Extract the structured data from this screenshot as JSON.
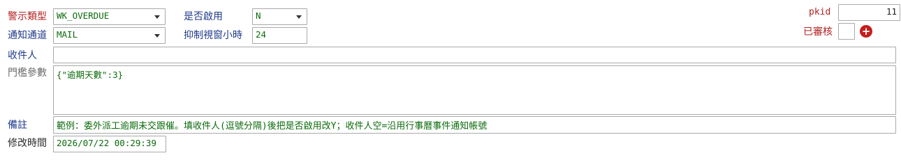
{
  "row1": {
    "alert_type_label": "警示類型",
    "alert_type_value": "WK_OVERDUE",
    "enabled_label": "是否啟用",
    "enabled_value": "N"
  },
  "row2": {
    "channel_label": "通知通道",
    "channel_value": "MAIL",
    "suppress_label": "抑制視窗小時",
    "suppress_value": "24"
  },
  "right": {
    "pkid_label": "pkid",
    "pkid_value": "11",
    "reviewed_label": "已審核",
    "add_icon": "plus-circle-icon"
  },
  "recipients": {
    "label": "收件人",
    "value": ""
  },
  "threshold": {
    "label": "門檻參數",
    "value": "{\"逾期天數\":3}"
  },
  "remark": {
    "label": "備註",
    "value": "範例：委外派工逾期未交跟催。填收件人(逗號分隔)後把是否啟用改Y；收件人空=沿用行事曆事件通知帳號"
  },
  "modified": {
    "label": "修改時間",
    "value": "2026/07/22 00:29:39"
  },
  "colors": {
    "required_label": "#b22222",
    "optional_label": "#1f3a8a",
    "field_text": "#0b6a0b",
    "add_button": "#c41e1e"
  }
}
